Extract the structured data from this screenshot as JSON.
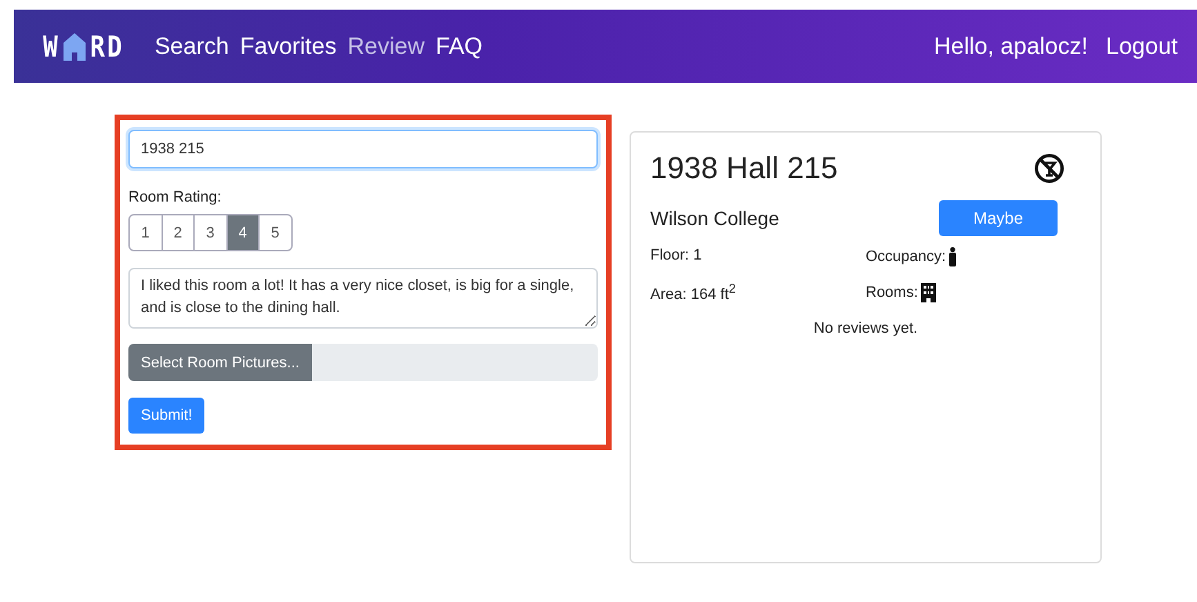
{
  "nav": {
    "logo_start": "W",
    "logo_end": "RD",
    "links": [
      {
        "label": "Search",
        "selected": false
      },
      {
        "label": "Favorites",
        "selected": false
      },
      {
        "label": "Review",
        "selected": true
      },
      {
        "label": "FAQ",
        "selected": false
      }
    ],
    "greeting": "Hello, apalocz!",
    "logout": "Logout"
  },
  "form": {
    "room_field": {
      "value": "1938 215"
    },
    "rating_label": "Room Rating:",
    "ratings": [
      {
        "label": "1",
        "selected": false
      },
      {
        "label": "2",
        "selected": false
      },
      {
        "label": "3",
        "selected": false
      },
      {
        "label": "4",
        "selected": true
      },
      {
        "label": "5",
        "selected": false
      }
    ],
    "review": {
      "value": "I liked this room a lot! It has a very nice closet, is big for a single, and is close to the dining hall."
    },
    "file_button": "Select Room Pictures...",
    "submit": "Submit!"
  },
  "card": {
    "title": "1938 Hall 215",
    "college": "Wilson College",
    "status_button": "Maybe",
    "floor": "Floor: 1",
    "occupancy": "Occupancy:",
    "area": "Area: 164 ft$^{2}$",
    "rooms": "Rooms:",
    "reviews": "No reviews yet."
  }
}
